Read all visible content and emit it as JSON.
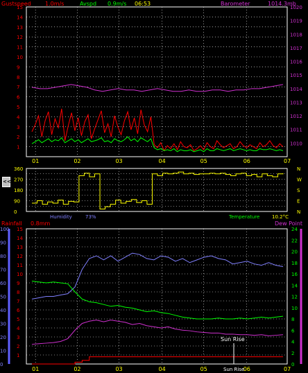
{
  "header_top": {
    "gust_label": "Gustspeed",
    "gust_value": "1.0m/s",
    "avg_label": "Avspd",
    "avg_value": "0.9m/s",
    "time": "06:53",
    "baro_label": "Barometer",
    "baro_value": "1014.3mb"
  },
  "header_mid": {
    "humidity_label": "Humidity",
    "humidity_value": "73%",
    "temp_label": "Temperature",
    "temp_value": "10.2°C",
    "rain_label": "Rainfall",
    "rain_value": "0.8mm",
    "dew_label": "Dew Point"
  },
  "side_button": "<<",
  "annotation": "Sun Rise",
  "xaxis_bottom_label": "Sun Rise",
  "colors": {
    "gust": "#ff0000",
    "avg": "#00ff00",
    "baro": "#d030d0",
    "wind_dir": "#ffff00",
    "humidity": "#8080ff",
    "temp": "#00ff00",
    "dew": "#d030d0",
    "rain": "#ff0000",
    "grid": "#ffffff"
  },
  "chart_data": [
    {
      "type": "line",
      "x_ticks": [
        "01",
        "02",
        "03",
        "04",
        "05",
        "06",
        "07"
      ],
      "ylim_left": [
        0,
        15
      ],
      "yticks_left": [
        1,
        2,
        3,
        4,
        5,
        6,
        7,
        8,
        9,
        10,
        11,
        12,
        13,
        14,
        15
      ],
      "ylim_right": [
        1009,
        1020
      ],
      "yticks_right": [
        1010,
        1011,
        1012,
        1013,
        1014,
        1015,
        1016,
        1017,
        1018,
        1019,
        1020
      ],
      "grid": true,
      "series": [
        {
          "name": "Gustspeed",
          "axis": "left",
          "values": [
            2.5,
            3.2,
            4.1,
            2.0,
            3.6,
            4.5,
            2.2,
            3.8,
            2.9,
            4.8,
            1.6,
            3.1,
            4.4,
            2.6,
            3.9,
            2.1,
            3.5,
            4.2,
            1.8,
            2.8,
            3.7,
            4.6,
            2.4,
            3.3,
            2.0,
            4.1,
            3.0,
            2.2,
            3.6,
            4.5,
            2.7,
            3.9,
            2.3,
            4.7,
            3.2,
            2.5,
            4.0,
            1.2,
            0.9,
            1.4,
            0.6,
            1.1,
            0.8,
            1.3,
            0.7,
            1.5,
            1.0,
            0.9,
            1.2,
            0.6,
            0.8,
            1.1,
            0.7,
            1.4,
            1.0,
            0.8,
            1.6,
            1.2,
            0.9,
            1.1,
            1.3,
            0.8,
            1.0,
            1.5,
            1.1,
            0.9,
            1.2,
            1.0,
            0.8,
            1.4,
            1.0,
            1.2,
            1.6,
            1.1,
            0.9,
            1.3,
            1.0
          ]
        },
        {
          "name": "Avspd",
          "axis": "left",
          "values": [
            1.3,
            1.5,
            1.7,
            1.4,
            1.6,
            1.8,
            1.5,
            1.7,
            1.6,
            1.9,
            1.4,
            1.6,
            1.8,
            1.5,
            1.7,
            1.4,
            1.6,
            1.8,
            1.5,
            1.6,
            1.7,
            1.9,
            1.5,
            1.6,
            1.4,
            1.8,
            1.6,
            1.5,
            1.7,
            2.0,
            1.6,
            1.8,
            1.5,
            1.9,
            1.7,
            1.5,
            1.8,
            0.9,
            0.7,
            0.8,
            0.6,
            0.7,
            0.6,
            0.8,
            0.5,
            0.7,
            0.6,
            0.6,
            0.7,
            0.5,
            0.6,
            0.7,
            0.5,
            0.8,
            0.6,
            0.6,
            0.8,
            0.7,
            0.6,
            0.7,
            0.8,
            0.6,
            0.7,
            0.8,
            0.7,
            0.6,
            0.7,
            0.6,
            0.6,
            0.8,
            0.7,
            0.7,
            0.8,
            0.7,
            0.6,
            0.7,
            0.6
          ]
        },
        {
          "name": "Barometer",
          "axis": "right",
          "values": [
            1014.1,
            1014.0,
            1014.0,
            1014.1,
            1014.2,
            1014.3,
            1014.2,
            1014.1,
            1013.9,
            1013.8,
            1013.9,
            1014.0,
            1013.9,
            1013.9,
            1013.8,
            1013.9,
            1014.0,
            1013.9,
            1013.8,
            1013.8,
            1013.9,
            1013.8,
            1013.8,
            1013.9,
            1013.9,
            1013.8,
            1013.9,
            1013.9,
            1014.0,
            1014.0,
            1014.1,
            1014.2,
            1014.3
          ]
        }
      ]
    },
    {
      "type": "line",
      "x_ticks": [
        "01",
        "02",
        "03",
        "04",
        "05",
        "06",
        "07"
      ],
      "ylim": [
        0,
        360
      ],
      "yticks": [
        0,
        45,
        90,
        135,
        180,
        225,
        270,
        315,
        360
      ],
      "right_labels": [
        "N",
        "W",
        "S",
        "E",
        "N"
      ],
      "grid": true,
      "series": [
        {
          "name": "Wind Direction",
          "values": [
            70,
            90,
            60,
            80,
            70,
            95,
            60,
            85,
            80,
            300,
            320,
            290,
            315,
            20,
            40,
            60,
            95,
            70,
            85,
            100,
            75,
            90,
            60,
            315,
            300,
            320,
            315,
            320,
            330,
            315,
            320,
            310,
            315,
            315,
            320,
            315,
            320,
            310,
            300,
            315,
            320,
            300,
            310,
            290,
            315,
            300,
            290,
            315,
            320
          ]
        }
      ]
    },
    {
      "type": "line",
      "x_ticks": [
        "01",
        "02",
        "03",
        "04",
        "05",
        "06",
        "07"
      ],
      "ylim_left": [
        0,
        100
      ],
      "yticks_left": [
        0,
        10,
        20,
        30,
        40,
        50,
        60,
        70,
        80,
        90,
        100
      ],
      "ylim_mid": [
        0,
        15
      ],
      "yticks_mid": [
        1,
        2,
        3,
        4,
        5,
        6,
        7,
        8,
        9,
        10,
        11,
        12,
        13,
        14,
        15
      ],
      "ylim_right": [
        0,
        24
      ],
      "yticks_right": [
        0,
        2,
        4,
        6,
        8,
        10,
        12,
        14,
        16,
        18,
        20,
        22,
        24
      ],
      "grid": true,
      "series": [
        {
          "name": "Humidity",
          "axis": "left",
          "values": [
            48,
            49,
            50,
            50,
            51,
            52,
            57,
            70,
            78,
            80,
            77,
            80,
            76,
            79,
            82,
            81,
            78,
            77,
            80,
            79,
            76,
            78,
            75,
            77,
            79,
            80,
            78,
            77,
            74,
            75,
            76,
            74,
            73,
            75,
            73,
            72
          ]
        },
        {
          "name": "Temperature",
          "axis": "mid",
          "values": [
            9.2,
            9.1,
            9.0,
            9.1,
            9.0,
            8.9,
            8.0,
            7.2,
            6.9,
            6.8,
            6.6,
            6.4,
            6.5,
            6.3,
            6.2,
            6.0,
            5.8,
            5.9,
            5.7,
            5.6,
            5.4,
            5.2,
            5.1,
            5.0,
            5.0,
            5.0,
            5.1,
            5.0,
            5.0,
            5.1,
            5.0,
            5.1,
            5.2,
            5.1,
            5.2,
            5.3
          ]
        },
        {
          "name": "Dew Point",
          "axis": "right",
          "values": [
            3.5,
            3.6,
            3.7,
            3.8,
            4.0,
            4.5,
            6.0,
            7.2,
            7.6,
            7.8,
            7.5,
            7.8,
            7.6,
            7.4,
            7.0,
            7.2,
            6.8,
            6.6,
            6.4,
            6.6,
            6.2,
            6.0,
            5.9,
            5.7,
            5.6,
            5.5,
            5.5,
            5.3,
            5.3,
            5.2,
            5.2,
            5.1,
            5.2,
            5.0,
            5.1,
            5.2
          ]
        },
        {
          "name": "Rainfall",
          "axis": "mid",
          "values": [
            0,
            0,
            0,
            0,
            0,
            0,
            0.2,
            0.4,
            0.8,
            0.8,
            0.8,
            0.8,
            0.8,
            0.8,
            0.8,
            0.8,
            0.8,
            0.8,
            0.8,
            0.8,
            0.8,
            0.8,
            0.8,
            0.8,
            0.8,
            0.8,
            0.8,
            0.8,
            0.8,
            0.8,
            0.8,
            0.8,
            0.8,
            0.8,
            0.8,
            0.8
          ]
        }
      ]
    }
  ]
}
